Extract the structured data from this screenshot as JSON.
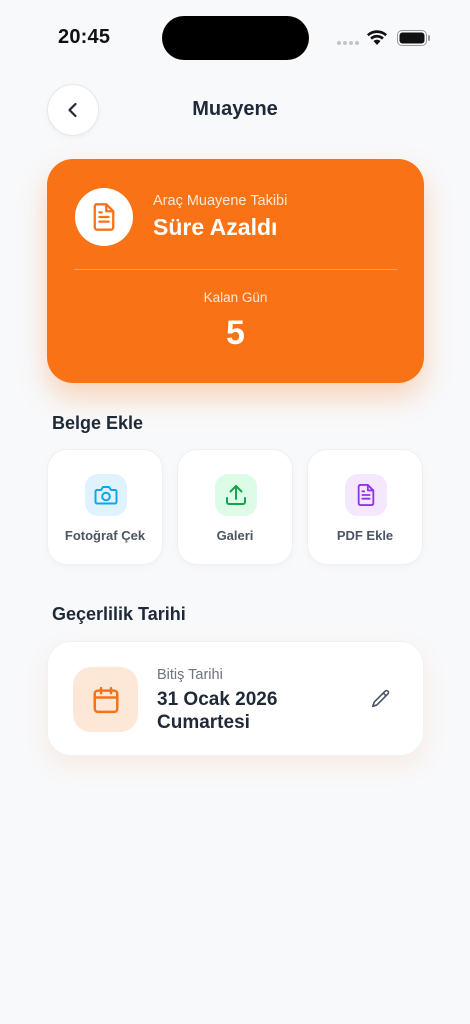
{
  "status_bar": {
    "time": "20:45"
  },
  "header": {
    "title": "Muayene"
  },
  "status_card": {
    "subtitle": "Araç Muayene Takibi",
    "title": "Süre Azaldı",
    "remaining_label": "Kalan Gün",
    "remaining_value": "5",
    "accent_color": "#f97316"
  },
  "documents": {
    "section_title": "Belge Ekle",
    "actions": [
      {
        "label": "Fotoğraf Çek",
        "icon": "camera-icon",
        "color": "#0ea5e9"
      },
      {
        "label": "Galeri",
        "icon": "upload-icon",
        "color": "#16a34a"
      },
      {
        "label": "PDF Ekle",
        "icon": "pdf-document-icon",
        "color": "#9333ea"
      }
    ]
  },
  "validity": {
    "section_title": "Geçerlilik Tarihi",
    "label": "Bitiş Tarihi",
    "date": "31 Ocak 2026",
    "weekday": "Cumartesi"
  }
}
